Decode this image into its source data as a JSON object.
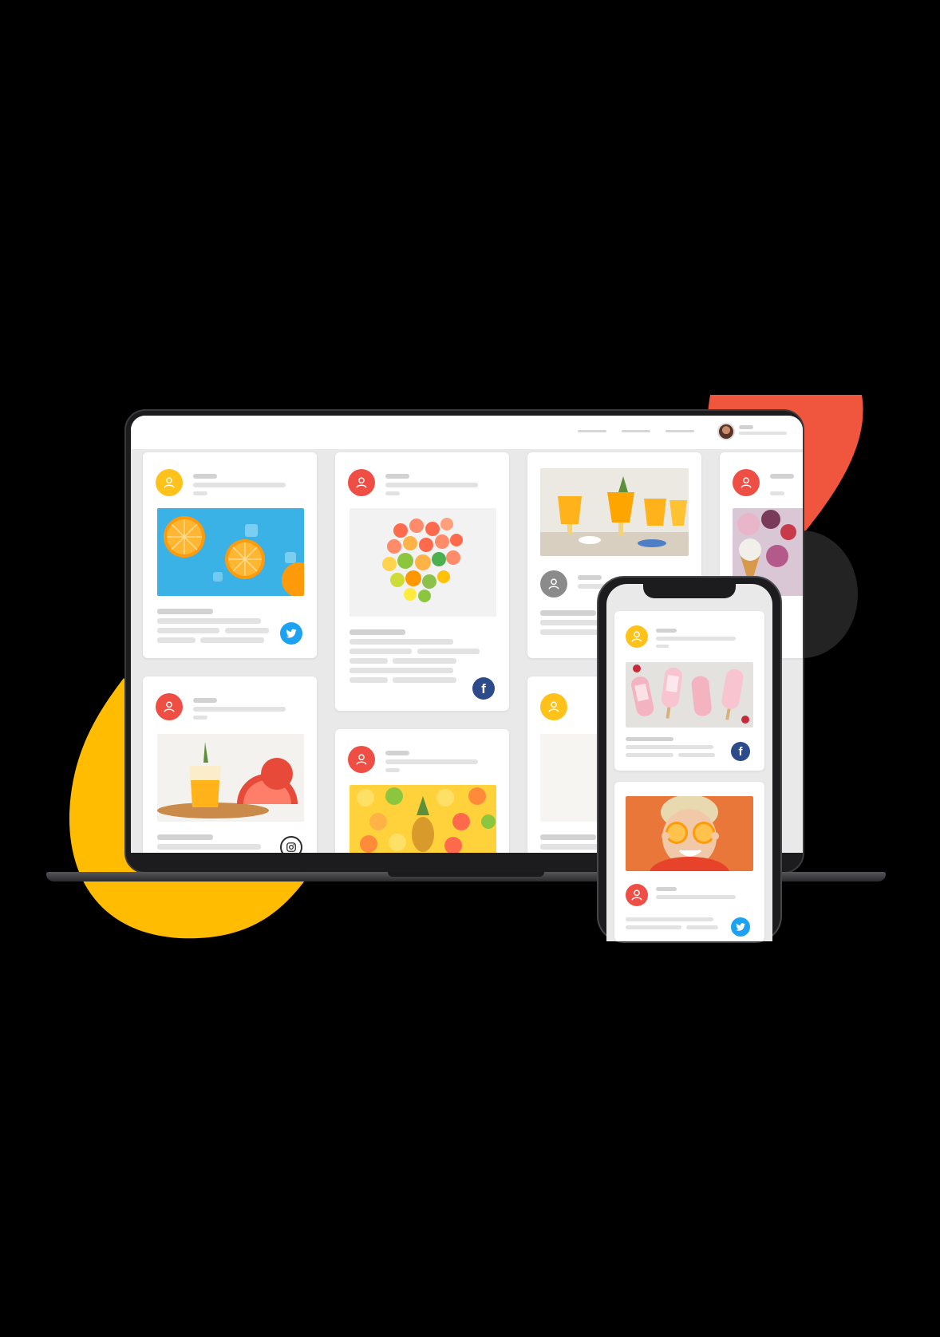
{
  "colors": {
    "background": "#000000",
    "accent_red": "#f0563d",
    "accent_yellow": "#ffbc00",
    "avatar_yellow": "#ffc21b",
    "avatar_red": "#ef4e44",
    "avatar_gray": "#8b8b8b",
    "twitter": "#1da1f2",
    "facebook": "#2d4a8a",
    "instagram": "#2b2b2b"
  },
  "icons": {
    "user": "user-icon",
    "twitter": "twitter-icon",
    "facebook": "facebook-icon",
    "instagram": "instagram-icon"
  },
  "laptop": {
    "cards": [
      {
        "id": "card-1",
        "avatar_color": "avatar_yellow",
        "photo": "oranges-on-blue",
        "social": "twitter"
      },
      {
        "id": "card-2",
        "avatar_color": "avatar_red",
        "photo": "citrus-slices",
        "social": "facebook"
      },
      {
        "id": "card-3",
        "avatar_color": "avatar_gray",
        "photo": "orange-drinks",
        "social": ""
      },
      {
        "id": "card-4",
        "avatar_color": "avatar_red",
        "photo": "ice-cream",
        "social": ""
      },
      {
        "id": "card-5",
        "avatar_color": "avatar_red",
        "photo": "juice-grapefruit",
        "social": "instagram"
      },
      {
        "id": "card-6",
        "avatar_color": "avatar_red",
        "photo": "pineapple-citrus",
        "social": ""
      },
      {
        "id": "card-7",
        "avatar_color": "avatar_yellow",
        "photo": "",
        "social": ""
      }
    ]
  },
  "phone": {
    "cards": [
      {
        "id": "phone-card-1",
        "avatar_color": "avatar_yellow",
        "photo": "popsicles",
        "social": "facebook"
      },
      {
        "id": "phone-card-2",
        "avatar_color": "avatar_red",
        "photo": "girl-with-oranges",
        "social": "twitter"
      }
    ]
  }
}
